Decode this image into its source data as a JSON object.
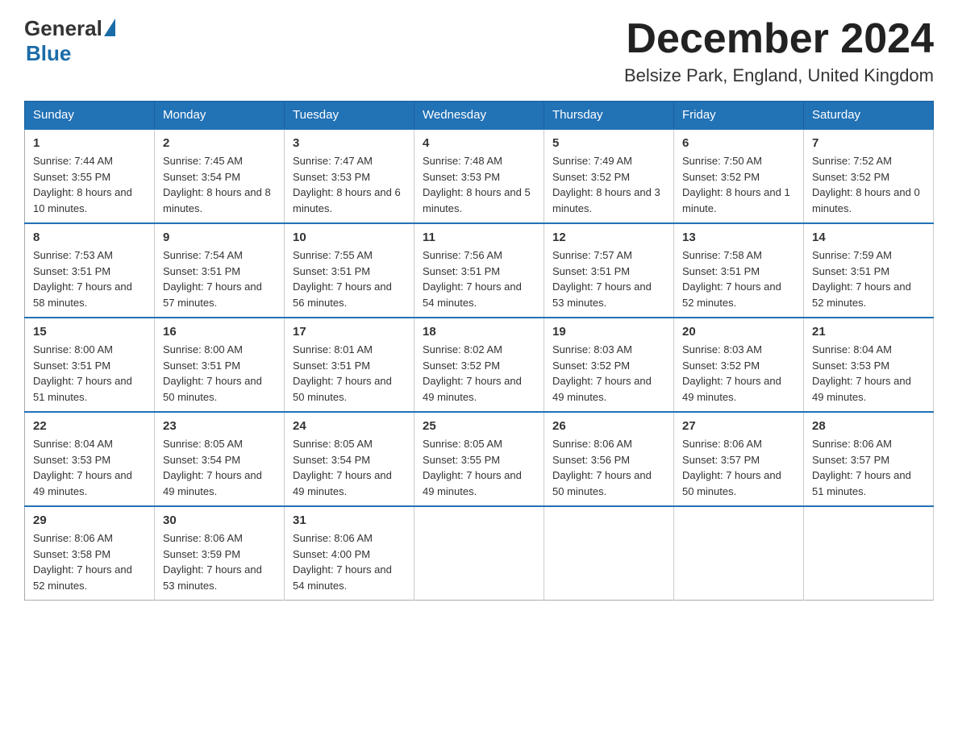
{
  "header": {
    "logo_general": "General",
    "logo_blue": "Blue",
    "month_title": "December 2024",
    "location": "Belsize Park, England, United Kingdom"
  },
  "days_of_week": [
    "Sunday",
    "Monday",
    "Tuesday",
    "Wednesday",
    "Thursday",
    "Friday",
    "Saturday"
  ],
  "weeks": [
    [
      {
        "day": "1",
        "sunrise": "7:44 AM",
        "sunset": "3:55 PM",
        "daylight": "8 hours and 10 minutes."
      },
      {
        "day": "2",
        "sunrise": "7:45 AM",
        "sunset": "3:54 PM",
        "daylight": "8 hours and 8 minutes."
      },
      {
        "day": "3",
        "sunrise": "7:47 AM",
        "sunset": "3:53 PM",
        "daylight": "8 hours and 6 minutes."
      },
      {
        "day": "4",
        "sunrise": "7:48 AM",
        "sunset": "3:53 PM",
        "daylight": "8 hours and 5 minutes."
      },
      {
        "day": "5",
        "sunrise": "7:49 AM",
        "sunset": "3:52 PM",
        "daylight": "8 hours and 3 minutes."
      },
      {
        "day": "6",
        "sunrise": "7:50 AM",
        "sunset": "3:52 PM",
        "daylight": "8 hours and 1 minute."
      },
      {
        "day": "7",
        "sunrise": "7:52 AM",
        "sunset": "3:52 PM",
        "daylight": "8 hours and 0 minutes."
      }
    ],
    [
      {
        "day": "8",
        "sunrise": "7:53 AM",
        "sunset": "3:51 PM",
        "daylight": "7 hours and 58 minutes."
      },
      {
        "day": "9",
        "sunrise": "7:54 AM",
        "sunset": "3:51 PM",
        "daylight": "7 hours and 57 minutes."
      },
      {
        "day": "10",
        "sunrise": "7:55 AM",
        "sunset": "3:51 PM",
        "daylight": "7 hours and 56 minutes."
      },
      {
        "day": "11",
        "sunrise": "7:56 AM",
        "sunset": "3:51 PM",
        "daylight": "7 hours and 54 minutes."
      },
      {
        "day": "12",
        "sunrise": "7:57 AM",
        "sunset": "3:51 PM",
        "daylight": "7 hours and 53 minutes."
      },
      {
        "day": "13",
        "sunrise": "7:58 AM",
        "sunset": "3:51 PM",
        "daylight": "7 hours and 52 minutes."
      },
      {
        "day": "14",
        "sunrise": "7:59 AM",
        "sunset": "3:51 PM",
        "daylight": "7 hours and 52 minutes."
      }
    ],
    [
      {
        "day": "15",
        "sunrise": "8:00 AM",
        "sunset": "3:51 PM",
        "daylight": "7 hours and 51 minutes."
      },
      {
        "day": "16",
        "sunrise": "8:00 AM",
        "sunset": "3:51 PM",
        "daylight": "7 hours and 50 minutes."
      },
      {
        "day": "17",
        "sunrise": "8:01 AM",
        "sunset": "3:51 PM",
        "daylight": "7 hours and 50 minutes."
      },
      {
        "day": "18",
        "sunrise": "8:02 AM",
        "sunset": "3:52 PM",
        "daylight": "7 hours and 49 minutes."
      },
      {
        "day": "19",
        "sunrise": "8:03 AM",
        "sunset": "3:52 PM",
        "daylight": "7 hours and 49 minutes."
      },
      {
        "day": "20",
        "sunrise": "8:03 AM",
        "sunset": "3:52 PM",
        "daylight": "7 hours and 49 minutes."
      },
      {
        "day": "21",
        "sunrise": "8:04 AM",
        "sunset": "3:53 PM",
        "daylight": "7 hours and 49 minutes."
      }
    ],
    [
      {
        "day": "22",
        "sunrise": "8:04 AM",
        "sunset": "3:53 PM",
        "daylight": "7 hours and 49 minutes."
      },
      {
        "day": "23",
        "sunrise": "8:05 AM",
        "sunset": "3:54 PM",
        "daylight": "7 hours and 49 minutes."
      },
      {
        "day": "24",
        "sunrise": "8:05 AM",
        "sunset": "3:54 PM",
        "daylight": "7 hours and 49 minutes."
      },
      {
        "day": "25",
        "sunrise": "8:05 AM",
        "sunset": "3:55 PM",
        "daylight": "7 hours and 49 minutes."
      },
      {
        "day": "26",
        "sunrise": "8:06 AM",
        "sunset": "3:56 PM",
        "daylight": "7 hours and 50 minutes."
      },
      {
        "day": "27",
        "sunrise": "8:06 AM",
        "sunset": "3:57 PM",
        "daylight": "7 hours and 50 minutes."
      },
      {
        "day": "28",
        "sunrise": "8:06 AM",
        "sunset": "3:57 PM",
        "daylight": "7 hours and 51 minutes."
      }
    ],
    [
      {
        "day": "29",
        "sunrise": "8:06 AM",
        "sunset": "3:58 PM",
        "daylight": "7 hours and 52 minutes."
      },
      {
        "day": "30",
        "sunrise": "8:06 AM",
        "sunset": "3:59 PM",
        "daylight": "7 hours and 53 minutes."
      },
      {
        "day": "31",
        "sunrise": "8:06 AM",
        "sunset": "4:00 PM",
        "daylight": "7 hours and 54 minutes."
      },
      null,
      null,
      null,
      null
    ]
  ]
}
